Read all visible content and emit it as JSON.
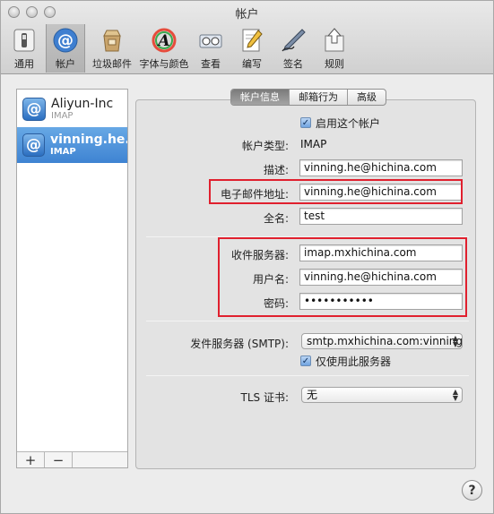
{
  "window": {
    "title": "帐户"
  },
  "toolbar": {
    "items": [
      {
        "label": "通用",
        "icon": "switch-icon"
      },
      {
        "label": "帐户",
        "icon": "at-icon"
      },
      {
        "label": "垃圾邮件",
        "icon": "junk-bag-icon"
      },
      {
        "label": "字体与颜色",
        "icon": "font-color-icon"
      },
      {
        "label": "查看",
        "icon": "glasses-icon"
      },
      {
        "label": "编写",
        "icon": "pencil-note-icon"
      },
      {
        "label": "签名",
        "icon": "signature-pen-icon"
      },
      {
        "label": "规则",
        "icon": "rules-arrow-icon"
      }
    ],
    "selected": "帐户"
  },
  "sidebar": {
    "accounts": [
      {
        "name": "Aliyun-Inc",
        "type": "IMAP"
      },
      {
        "name": "vinning.he...",
        "type": "IMAP"
      }
    ],
    "add_label": "+",
    "remove_label": "−"
  },
  "tabs": {
    "items": [
      "帐户信息",
      "邮箱行为",
      "高级"
    ],
    "active": "帐户信息"
  },
  "account_info": {
    "enable_label": "启用这个帐户",
    "enable_checked": true,
    "type_label": "帐户类型:",
    "type_value": "IMAP",
    "description_label": "描述:",
    "description_value": "vinning.he@hichina.com",
    "email_label": "电子邮件地址:",
    "email_value": "vinning.he@hichina.com",
    "fullname_label": "全名:",
    "fullname_value": "test",
    "incoming_label": "收件服务器:",
    "incoming_value": "imap.mxhichina.com",
    "username_label": "用户名:",
    "username_value": "vinning.he@hichina.com",
    "password_label": "密码:",
    "password_value": "•••••••••••",
    "smtp_label": "发件服务器 (SMTP):",
    "smtp_value": "smtp.mxhichina.com:vinning.",
    "only_server_label": "仅使用此服务器",
    "only_server_checked": true,
    "tls_label": "TLS 证书:",
    "tls_value": "无"
  },
  "help": {
    "label": "?"
  },
  "colors": {
    "highlight": "#e0202e",
    "selection": "#3e83d2"
  }
}
